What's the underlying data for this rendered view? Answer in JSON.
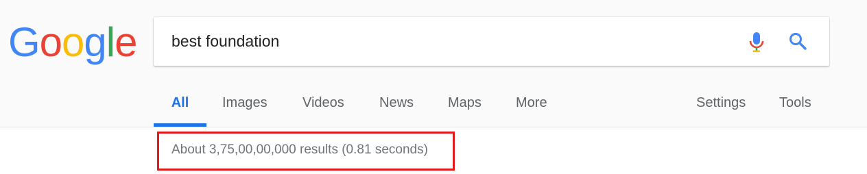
{
  "logo": {
    "letters": [
      "G",
      "o",
      "o",
      "g",
      "l",
      "e"
    ],
    "colors": [
      "#4285f4",
      "#ea4335",
      "#fbbc05",
      "#4285f4",
      "#34a853",
      "#ea4335"
    ]
  },
  "search": {
    "value": "best foundation",
    "mic_icon": "microphone-icon",
    "search_icon": "magnifier-icon"
  },
  "tabs": [
    {
      "label": "All",
      "active": true
    },
    {
      "label": "Images",
      "active": false
    },
    {
      "label": "Videos",
      "active": false
    },
    {
      "label": "News",
      "active": false
    },
    {
      "label": "Maps",
      "active": false
    },
    {
      "label": "More",
      "active": false
    }
  ],
  "tools": {
    "settings_label": "Settings",
    "tools_label": "Tools"
  },
  "results": {
    "stats": "About 3,75,00,00,000 results (0.81 seconds)"
  },
  "colors": {
    "accent_blue": "#1a73e8",
    "highlight_red": "#e0191b",
    "header_bg": "#fafafa"
  }
}
